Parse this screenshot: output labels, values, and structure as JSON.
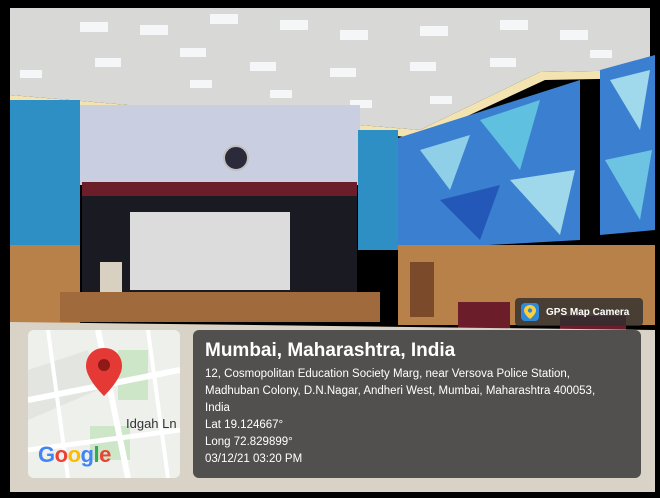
{
  "map": {
    "street_label": "Idgah Ln",
    "logo_text": [
      "G",
      "o",
      "o",
      "g",
      "l",
      "e"
    ],
    "logo_colors": [
      "#4285F4",
      "#EA4335",
      "#FBBC05",
      "#4285F4",
      "#34A853",
      "#EA4335"
    ],
    "pin_color": "#E53935"
  },
  "location": {
    "title": "Mumbai, Maharashtra, India",
    "address_lines": [
      "12, Cosmopolitan Education Society Marg, near Versova Police Station,",
      "Madhuban Colony, D.N.Nagar, Andheri West, Mumbai, Maharashtra 400053,",
      "India"
    ],
    "lat": "Lat 19.124667°",
    "long": "Long 72.829899°",
    "timestamp": "03/12/21 03:20 PM"
  },
  "badge": {
    "label": "GPS Map Camera",
    "icon": "gps-map-camera-icon"
  },
  "colors": {
    "wall_blue": "#2d8fc4",
    "curtain_maroon": "#6b1e2a",
    "wood": "#b9814a",
    "floor": "#d9d2c6"
  }
}
